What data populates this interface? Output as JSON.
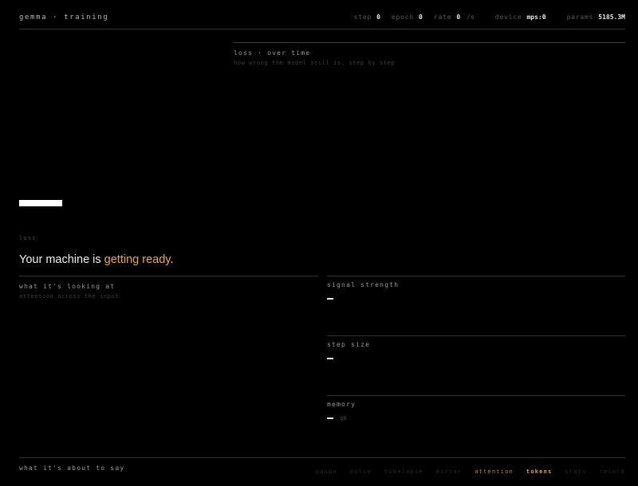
{
  "header": {
    "title": "gemma · training",
    "stats": [
      {
        "key": "step",
        "value": "0",
        "unit": ""
      },
      {
        "key": "epoch",
        "value": "0",
        "unit": ""
      },
      {
        "key": "rate",
        "value": "0",
        "unit": "/s"
      },
      {
        "key": "device",
        "value": "mps:0",
        "unit": ""
      },
      {
        "key": "params",
        "value": "5185.3M",
        "unit": ""
      }
    ]
  },
  "loss_panel": {
    "title": "loss · over time",
    "subtitle": "how wrong the model still is, step by step"
  },
  "loss": {
    "label": "loss",
    "status_prefix": "Your machine is ",
    "status_highlight": "getting ready",
    "status_suffix": "."
  },
  "attention_panel": {
    "title": "what it's looking at",
    "subtitle": "attention across the input"
  },
  "metrics": [
    {
      "title": "signal strength",
      "value": "—",
      "unit": ""
    },
    {
      "title": "step size",
      "value": "—",
      "unit": ""
    },
    {
      "title": "memory",
      "value": "—",
      "unit": "gb"
    }
  ],
  "footer": {
    "title": "what it's about to say",
    "tabs": [
      "gauge",
      "pulse",
      "timelapse",
      "mirror",
      "attention",
      "tokens",
      "stats",
      "record"
    ]
  },
  "colors": {
    "background": "#000000",
    "accent": "#e8a75c"
  }
}
